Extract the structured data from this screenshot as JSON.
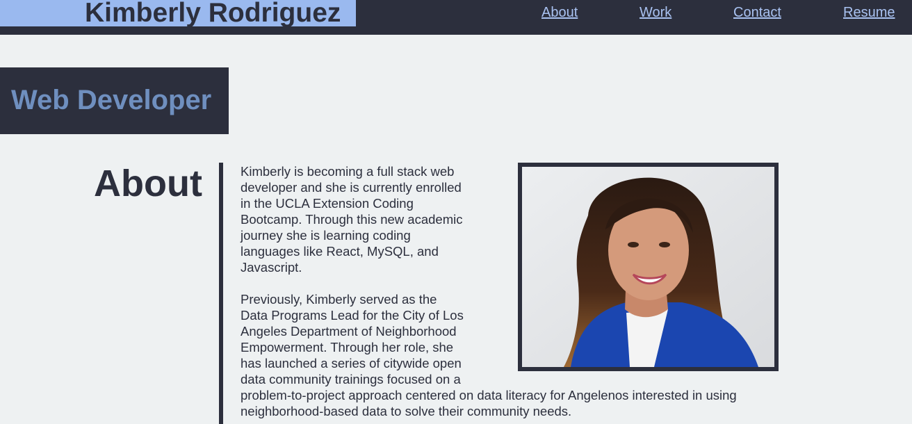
{
  "header": {
    "name": "Kimberly Rodriguez",
    "nav": {
      "about": "About",
      "work": "Work",
      "contact": "Contact",
      "resume": "Resume"
    }
  },
  "hero": {
    "title": "Web Developer"
  },
  "about": {
    "heading": "About",
    "paragraph_1": "Kimberly is becoming a full stack web developer and she is currently enrolled in the UCLA Extension Coding Bootcamp. Through this new academic journey she is learning coding languages like React, MySQL, and Javascript.",
    "paragraph_2": "Previously, Kimberly served as the Data Programs Lead for the City of Los Angeles Department of Neighborhood Empowerment. Through her role, she has launched a series of citywide open data community trainings focused on a problem-to-project approach centered on data literacy for Angelenos interested in using neighborhood-based data to solve their community needs."
  },
  "colors": {
    "dark": "#2c2f3d",
    "accent": "#9ab9ef",
    "link": "#a9c2f1",
    "hero_text": "#6f8fbf",
    "background": "#eef1f2"
  }
}
